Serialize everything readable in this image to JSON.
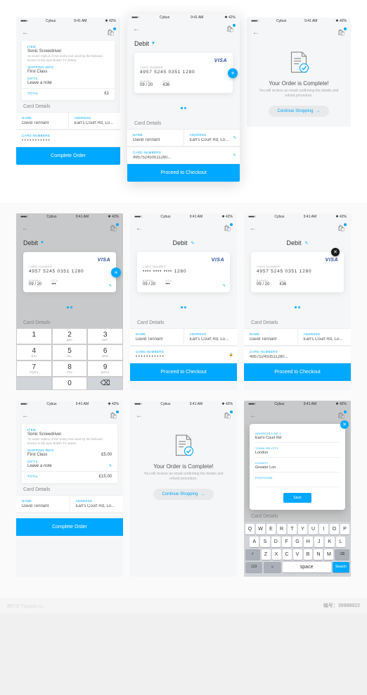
{
  "status": {
    "carrier": "Cybus",
    "time": "9:41 AM",
    "battery": "42%",
    "signal": "●●●●○"
  },
  "nav": {
    "back": "←",
    "cart": "🛒"
  },
  "payment": {
    "type": "Debit",
    "brand": "VISA",
    "card_number_label": "CARD NUMBER",
    "card_number": "4957 5245 0351 1280",
    "card_masked": "•••• •••• •••• 1280",
    "expiry_label": "EXPIRY",
    "expiry": "09 / 20",
    "ccv_label": "CCV",
    "ccv": "436"
  },
  "details": {
    "section": "Card Details",
    "name_label": "NAME",
    "name": "David Tennant",
    "address_label": "ADDRESS",
    "address": "Earl's Court Rd, Lo...",
    "number_label": "CARD NUMBERS",
    "number_masked": "• • • • • • • • • • •",
    "number_full": "495752450511280..."
  },
  "btns": {
    "complete": "Complete Order",
    "proceed": "Proceed to Checkout",
    "continue": "Continue Shopping",
    "save": "Save"
  },
  "summary": {
    "item_label": "ITEM",
    "item": "Sonic Screwdriver",
    "item_desc": "An exact replica of the trusty tool used by the beloved Doctor in the epic British TV series.",
    "shipping_label": "SHIPPING INFO",
    "shipping": "First Class",
    "shipping_price": "£5.00",
    "gifts_label": "GIFTS",
    "gifts": "Leave a note",
    "total_label": "TOTAL",
    "total": "£15.00",
    "total_partial": "£1"
  },
  "complete": {
    "title": "Your Order is Complete!",
    "msg": "You will recieve an email confirming the details and refund procedure."
  },
  "keypad": {
    "k1": {
      "n": "1",
      "l": ""
    },
    "k2": {
      "n": "2",
      "l": "ABC"
    },
    "k3": {
      "n": "3",
      "l": "DEF"
    },
    "k4": {
      "n": "4",
      "l": "GHI"
    },
    "k5": {
      "n": "5",
      "l": "JKL"
    },
    "k6": {
      "n": "6",
      "l": "MNO"
    },
    "k7": {
      "n": "7",
      "l": "PQRS"
    },
    "k8": {
      "n": "8",
      "l": "TUV"
    },
    "k9": {
      "n": "9",
      "l": "WXYZ"
    },
    "k0": {
      "n": "0",
      "l": ""
    },
    "del": "⌫"
  },
  "address": {
    "line1_label": "ADDRESS LINE 1",
    "line1": "Earl's Court Rd",
    "town_label": "TOWN OR CITY",
    "town": "London",
    "county_label": "COUNTY",
    "county": "Greater Lon",
    "postcode_label": "POSTCODE",
    "postcode": ""
  },
  "kb_rows": {
    "r1": [
      "Q",
      "W",
      "E",
      "R",
      "T",
      "Y",
      "U",
      "I",
      "O",
      "P"
    ],
    "r2": [
      "A",
      "S",
      "D",
      "F",
      "G",
      "H",
      "J",
      "K",
      "L"
    ],
    "r3": [
      "Z",
      "X",
      "C",
      "V",
      "B",
      "N",
      "M"
    ]
  },
  "watermark": {
    "site": "图行天下pspfoto.cn",
    "id": "编号：39988922"
  }
}
